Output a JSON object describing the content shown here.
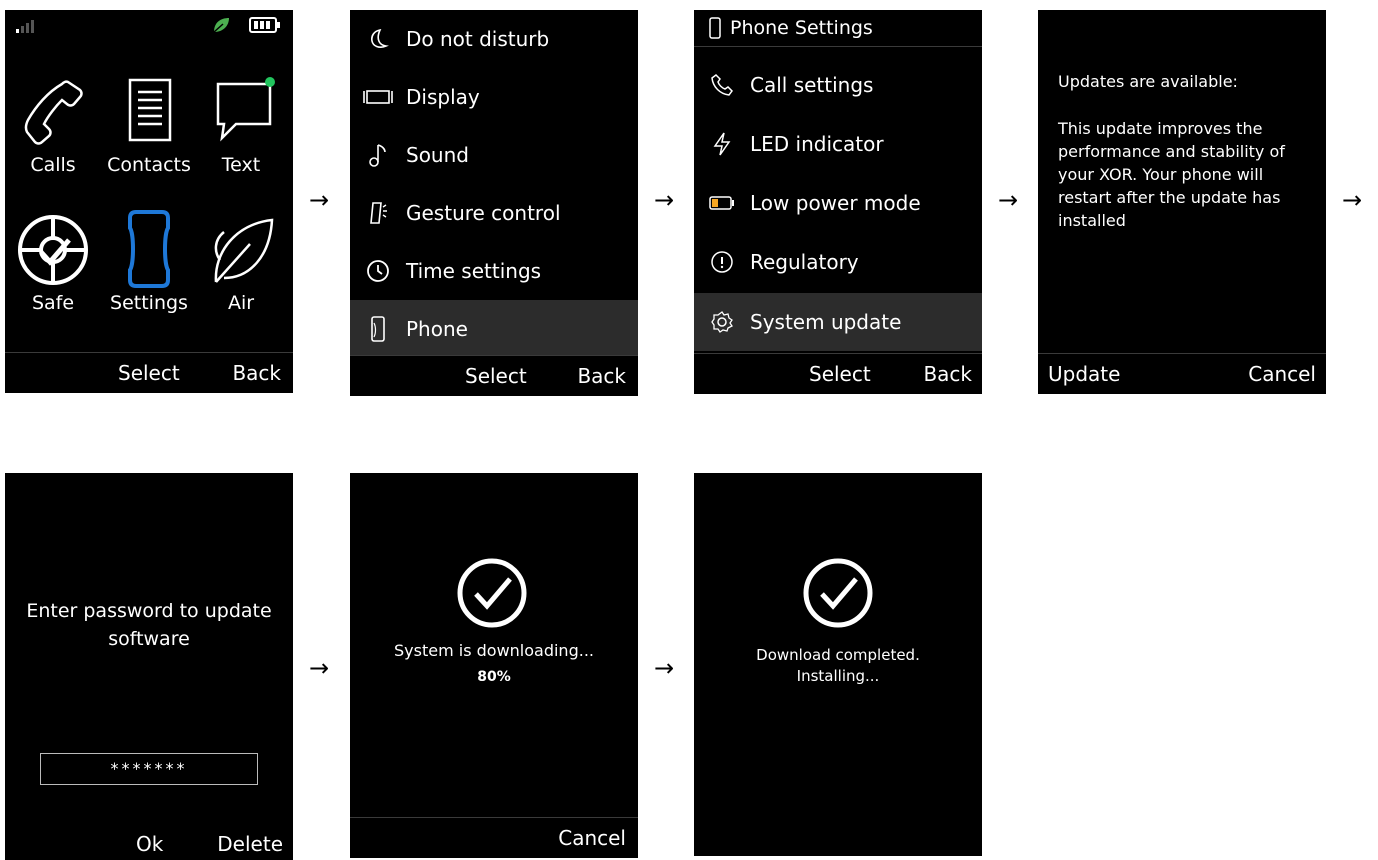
{
  "screens": {
    "home": {
      "apps": [
        {
          "label": "Calls",
          "icon": "phone-handset-icon"
        },
        {
          "label": "Contacts",
          "icon": "contacts-list-icon"
        },
        {
          "label": "Text",
          "icon": "chat-bubble-icon"
        },
        {
          "label": "Safe",
          "icon": "safe-icon"
        },
        {
          "label": "Settings",
          "icon": "phone-device-icon"
        },
        {
          "label": "Air",
          "icon": "leaf-icon"
        }
      ],
      "softkeys": {
        "select": "Select",
        "back": "Back"
      }
    },
    "settings": {
      "items": [
        {
          "label": "Do not disturb",
          "icon": "moon-icon"
        },
        {
          "label": "Display",
          "icon": "display-icon"
        },
        {
          "label": "Sound",
          "icon": "music-note-icon"
        },
        {
          "label": "Gesture control",
          "icon": "gesture-icon"
        },
        {
          "label": "Time settings",
          "icon": "clock-icon"
        },
        {
          "label": "Phone",
          "icon": "phone-device-icon",
          "selected": true
        }
      ],
      "softkeys": {
        "select": "Select",
        "back": "Back"
      }
    },
    "phone_settings": {
      "title": "Phone Settings",
      "items": [
        {
          "label": "Call settings",
          "icon": "phone-handset-icon"
        },
        {
          "label": "LED indicator",
          "icon": "lightning-icon"
        },
        {
          "label": "Low power mode",
          "icon": "battery-low-icon"
        },
        {
          "label": "Regulatory",
          "icon": "info-icon"
        },
        {
          "label": "System update",
          "icon": "gear-icon",
          "selected": true
        }
      ],
      "softkeys": {
        "select": "Select",
        "back": "Back"
      }
    },
    "update_available": {
      "heading": "Updates are available:",
      "body": "This update improves the performance and stability of your XOR. Your phone will restart after the update has installed",
      "softkeys": {
        "update": "Update",
        "cancel": "Cancel"
      }
    },
    "password": {
      "prompt": "Enter password to update software",
      "masked_value": "*******",
      "softkeys": {
        "ok": "Ok",
        "delete": "Delete"
      }
    },
    "downloading": {
      "message": "System is downloading...",
      "progress_text": "80%",
      "softkeys": {
        "cancel": "Cancel"
      }
    },
    "completed": {
      "line1": "Download completed.",
      "line2": "Installing..."
    }
  },
  "flow_arrow": "→",
  "colors": {
    "accent_blue": "#1e78d8",
    "leaf_green": "#4caf50",
    "notify_dot": "#22c55e",
    "selected_row": "#2c2c2c",
    "battery_orange": "#f5a623"
  }
}
